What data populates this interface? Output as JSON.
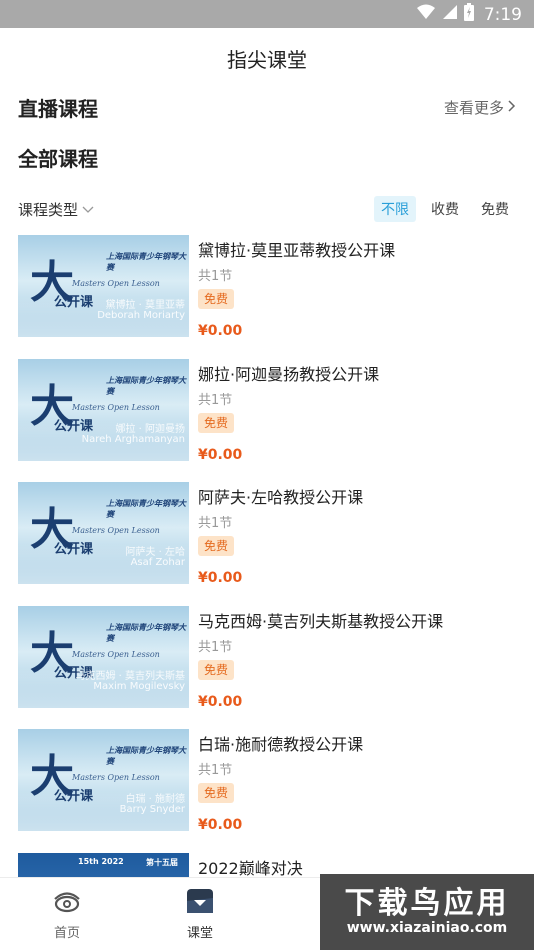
{
  "status_bar": {
    "time": "7:19",
    "icons": [
      "wifi-icon",
      "signal-icon",
      "battery-icon"
    ]
  },
  "header": {
    "title": "指尖课堂"
  },
  "live_section": {
    "title": "直播课程",
    "more_label": "查看更多"
  },
  "all_section": {
    "title": "全部课程"
  },
  "filter": {
    "type_label": "课程类型",
    "tabs": [
      {
        "label": "不限",
        "active": true
      },
      {
        "label": "收费",
        "active": false
      },
      {
        "label": "免费",
        "active": false
      }
    ]
  },
  "courses": [
    {
      "title": "黛博拉·莫里亚蒂教授公开课",
      "lessons": "共1节",
      "badge": "免费",
      "price": "¥0.00",
      "thumb_cn": "黛博拉 · 莫里亚蒂",
      "thumb_en": "Deborah Moriarty"
    },
    {
      "title": "娜拉·阿迦曼扬教授公开课",
      "lessons": "共1节",
      "badge": "免费",
      "price": "¥0.00",
      "thumb_cn": "娜拉 · 阿迦曼扬",
      "thumb_en": "Nareh Arghamanyan"
    },
    {
      "title": "阿萨夫·左哈教授公开课",
      "lessons": "共1节",
      "badge": "免费",
      "price": "¥0.00",
      "thumb_cn": "阿萨夫 · 左哈",
      "thumb_en": "Asaf Zohar"
    },
    {
      "title": "马克西姆·莫吉列夫斯基教授公开课",
      "lessons": "共1节",
      "badge": "免费",
      "price": "¥0.00",
      "thumb_cn": "马克西姆 · 莫吉列夫斯基",
      "thumb_en": "Maxim Mogilevsky"
    },
    {
      "title": "白瑞·施耐德教授公开课",
      "lessons": "共1节",
      "badge": "免费",
      "price": "¥0.00",
      "thumb_cn": "白瑞 · 施耐德",
      "thumb_en": "Barry Snyder"
    },
    {
      "title": "2022巅峰对决"
    }
  ],
  "thumb_common": {
    "line1": "上海国际青少年钢琴大赛",
    "open_lesson": "Masters Open Lesson",
    "big_char": "大",
    "public_class": "公开课"
  },
  "thumb_v2": {
    "year": "15th 2022",
    "edition": "第十五届"
  },
  "tab_bar": {
    "items": [
      {
        "label": "首页",
        "icon": "home-icon"
      },
      {
        "label": "课堂",
        "icon": "classroom-icon"
      }
    ]
  },
  "watermark": {
    "title": "下载鸟应用",
    "url": "www.xiazainiao.com"
  },
  "colors": {
    "accent": "#2a9fd8",
    "price": "#e85a1b",
    "badge_bg": "#fde3c8",
    "badge_text": "#e46a1f"
  }
}
